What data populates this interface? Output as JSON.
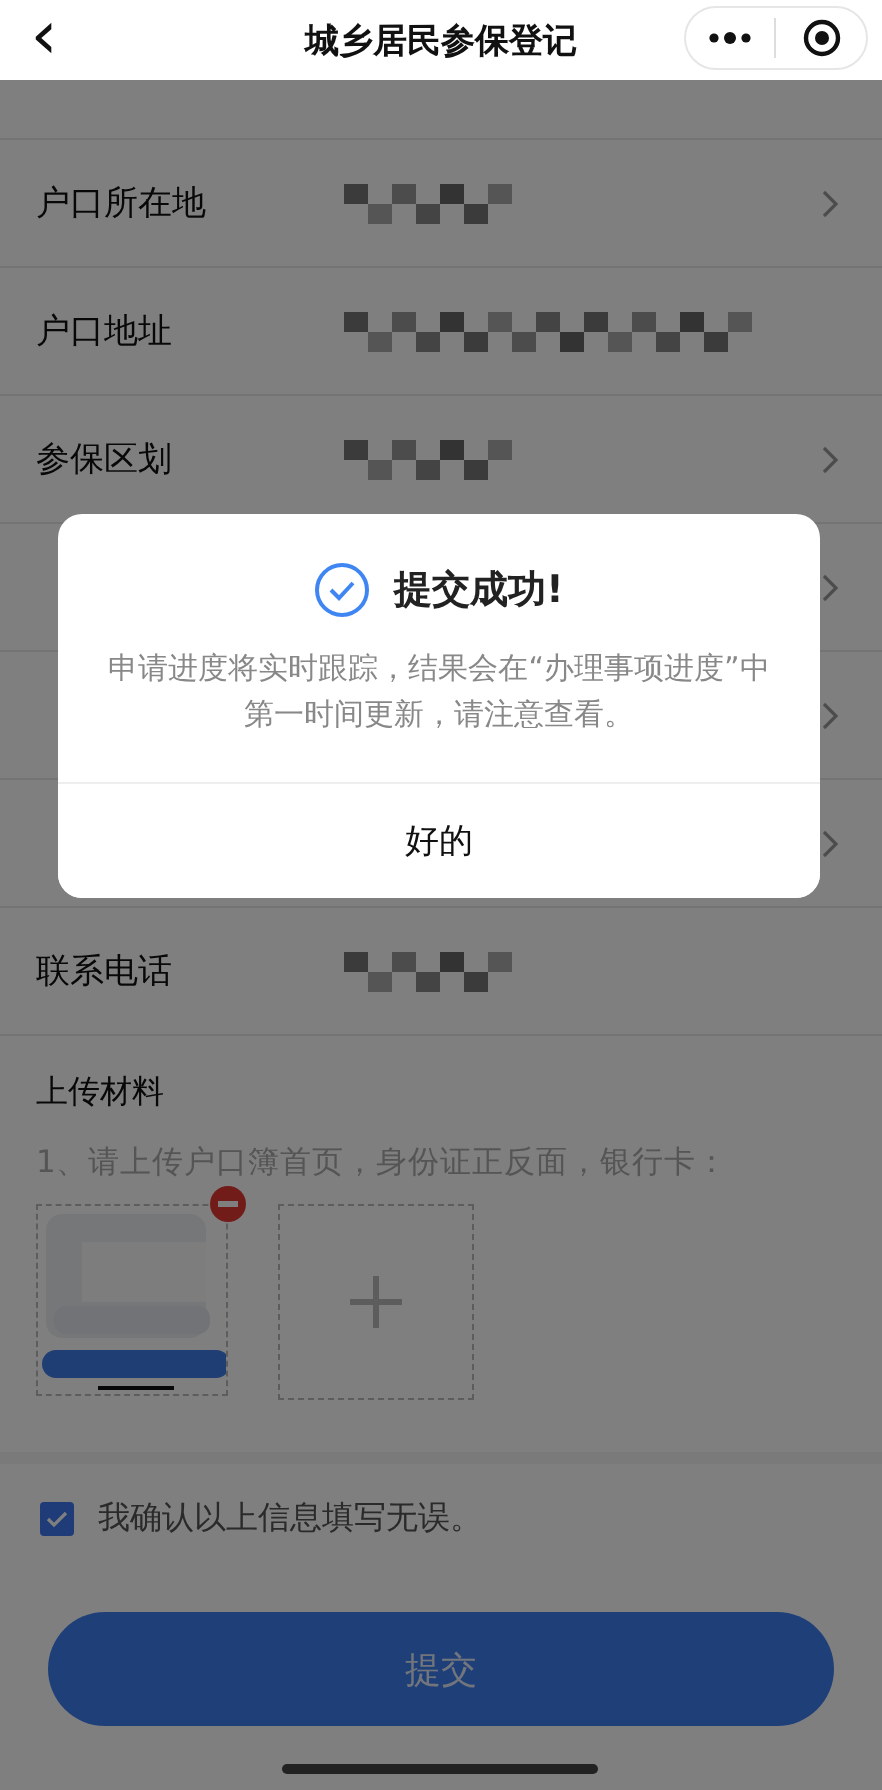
{
  "nav": {
    "back": "‹",
    "title": "城乡居民参保登记"
  },
  "rows": [
    {
      "label": null,
      "blurred": false,
      "chevron": false,
      "kind": "cut"
    },
    {
      "label": "户口所在地",
      "blurred": true,
      "chevron": true,
      "kind": "row"
    },
    {
      "label": "户口地址",
      "blurred": true,
      "chevron": false,
      "kind": "wide"
    },
    {
      "label": "参保区划",
      "blurred": true,
      "chevron": true,
      "kind": "row"
    },
    {
      "label": null,
      "blurred": false,
      "chevron": true,
      "kind": "row"
    },
    {
      "label": null,
      "blurred": false,
      "chevron": true,
      "kind": "row"
    },
    {
      "label": null,
      "blurred": false,
      "chevron": true,
      "kind": "row"
    },
    {
      "label": "联系电话",
      "blurred": true,
      "chevron": false,
      "kind": "row"
    }
  ],
  "upload": {
    "title": "上传材料",
    "hint": "1、请上传户口簿首页，身份证正反面，银行卡："
  },
  "confirm": {
    "label": "我确认以上信息填写无误。",
    "checked": true
  },
  "submit": "提交",
  "dialog": {
    "title": "提交成功!",
    "message": "申请进度将实时跟踪，结果会在“办理事项进度”中第一时间更新，请注意查看。",
    "button": "好的"
  }
}
